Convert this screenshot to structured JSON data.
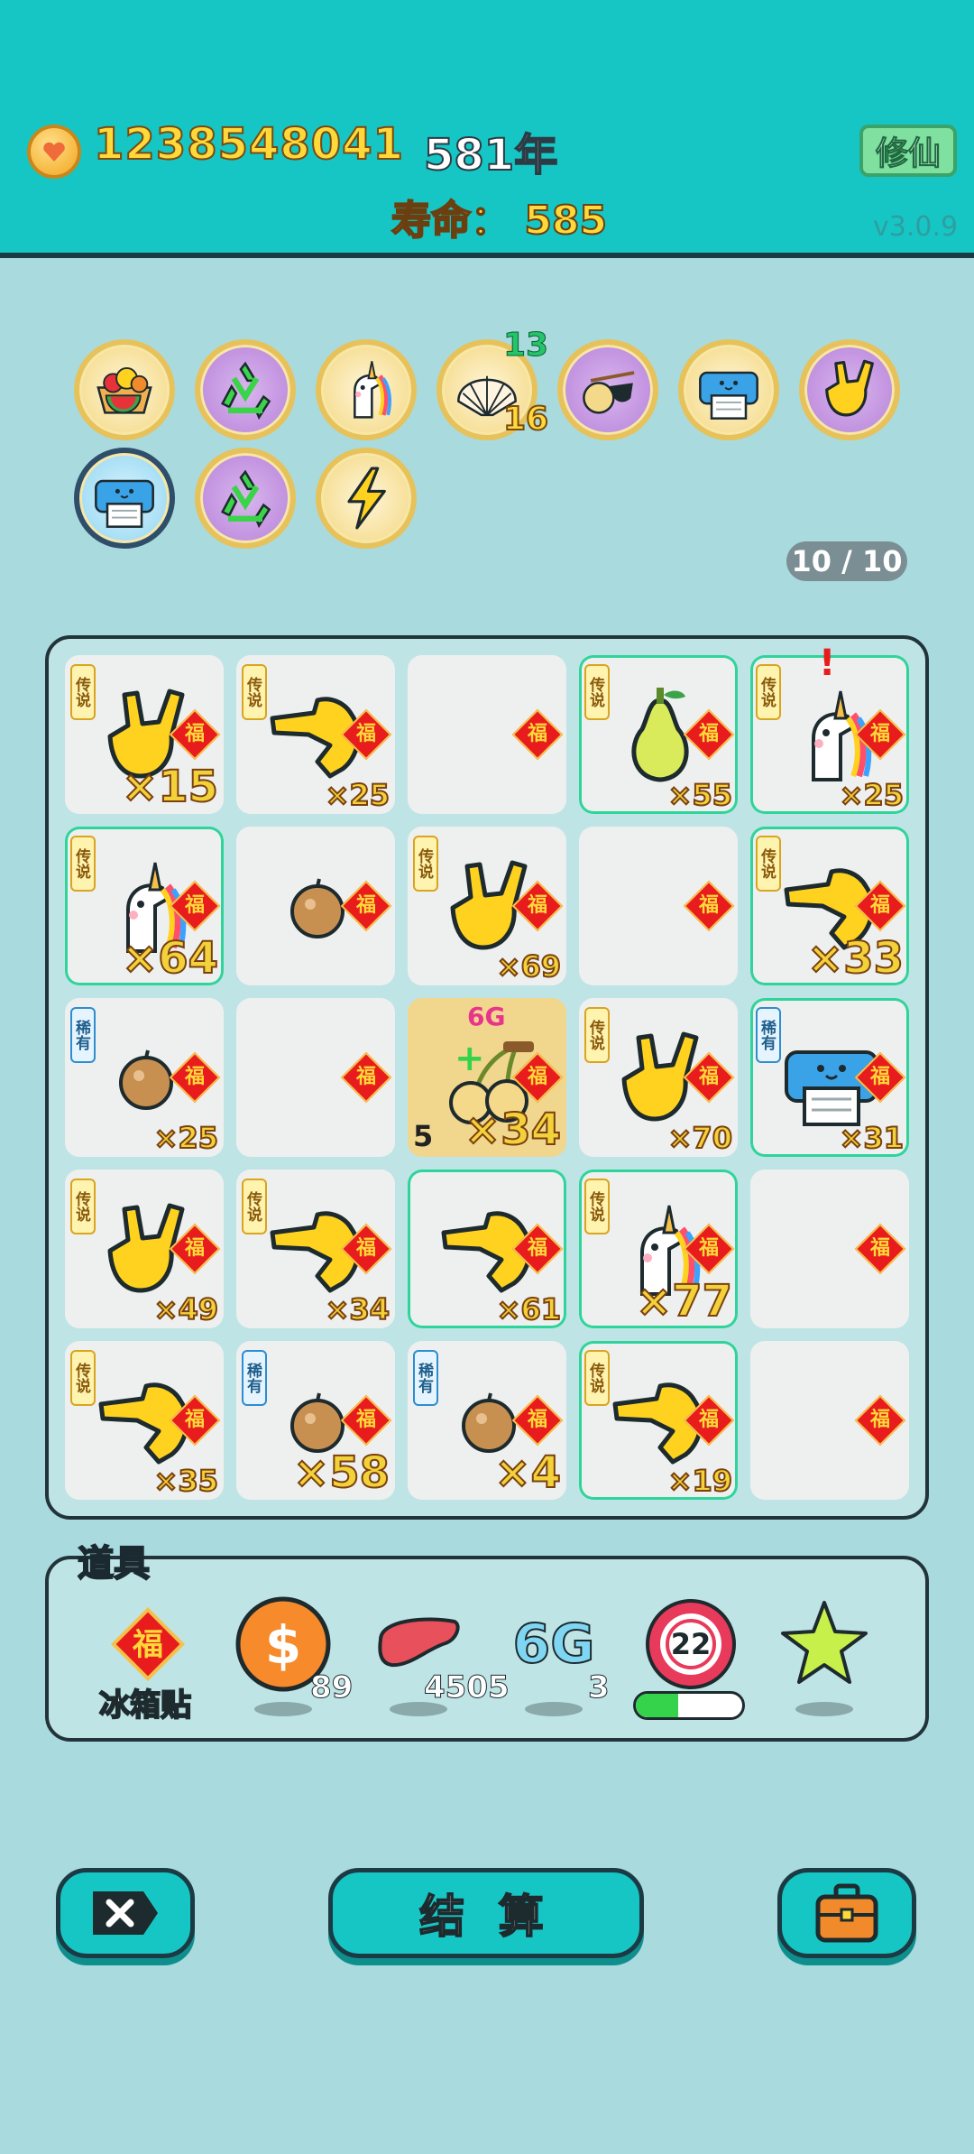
{
  "header": {
    "coins": "1238548041",
    "year": "581年",
    "lifespan": "寿命： 585",
    "xiuxian_button": "修仙",
    "version": "v3.0.9"
  },
  "buffs": [
    {
      "icon": "fruit-basket-icon",
      "style": "gold"
    },
    {
      "icon": "recycle-icon",
      "style": "purple"
    },
    {
      "icon": "unicorn-icon",
      "style": "gold"
    },
    {
      "icon": "shell-icon",
      "style": "gold",
      "top_number": "13",
      "bottom_number": "16"
    },
    {
      "icon": "sunglasses-fruit-icon",
      "style": "purple"
    },
    {
      "icon": "printer-icon",
      "style": "gold"
    },
    {
      "icon": "rock-hand-icon",
      "style": "purple"
    },
    {
      "icon": "printer-icon",
      "style": "blue"
    },
    {
      "icon": "recycle-icon",
      "style": "purple"
    },
    {
      "icon": "lightning-icon",
      "style": "gold"
    }
  ],
  "page_count": "10 / 10",
  "grid": [
    [
      {
        "tag": "传说",
        "item": "rock-hand-icon",
        "count": "×15",
        "size": "l"
      },
      {
        "tag": "传说",
        "item": "point-hand-icon",
        "count": "×25",
        "size": "s"
      },
      {
        "tag": "",
        "item": "",
        "count": "",
        "size": "s"
      },
      {
        "tag": "传说",
        "item": "pear-icon",
        "count": "×55",
        "size": "s",
        "highlight": true
      },
      {
        "tag": "传说",
        "item": "unicorn-icon",
        "count": "×25",
        "size": "s",
        "highlight": true,
        "alert": "!"
      }
    ],
    [
      {
        "tag": "传说",
        "item": "unicorn-icon",
        "count": "×64",
        "size": "l",
        "highlight": true
      },
      {
        "tag": "",
        "item": "nut-icon",
        "count": "",
        "size": "s"
      },
      {
        "tag": "传说",
        "item": "rock-hand-icon",
        "count": "×69",
        "size": "s"
      },
      {
        "tag": "",
        "item": "",
        "count": "",
        "size": "s"
      },
      {
        "tag": "传说",
        "item": "point-hand-icon",
        "count": "×33",
        "size": "l",
        "highlight": true
      }
    ],
    [
      {
        "tag": "稀有",
        "item": "nut-icon",
        "count": "×25",
        "size": "s"
      },
      {
        "tag": "",
        "item": "",
        "count": "",
        "size": "s"
      },
      {
        "tag": "",
        "item": "cherry-icon",
        "count": "×34",
        "size": "l",
        "gold": true,
        "level": "5",
        "badge": "6G"
      },
      {
        "tag": "传说",
        "item": "rock-hand-icon",
        "count": "×70",
        "size": "s"
      },
      {
        "tag": "稀有",
        "item": "printer-icon",
        "count": "×31",
        "size": "s",
        "highlight": true
      }
    ],
    [
      {
        "tag": "传说",
        "item": "rock-hand-icon",
        "count": "×49",
        "size": "s"
      },
      {
        "tag": "传说",
        "item": "point-hand-icon",
        "count": "×34",
        "size": "s"
      },
      {
        "tag": "",
        "item": "point-hand-icon",
        "count": "×61",
        "size": "s",
        "highlight": true
      },
      {
        "tag": "传说",
        "item": "unicorn-icon",
        "count": "×77",
        "size": "l",
        "highlight": true
      },
      {
        "tag": "",
        "item": "",
        "count": "",
        "size": "s"
      }
    ],
    [
      {
        "tag": "传说",
        "item": "point-hand-icon",
        "count": "×35",
        "size": "s"
      },
      {
        "tag": "稀有",
        "item": "nut-icon",
        "count": "×58",
        "size": "l"
      },
      {
        "tag": "稀有",
        "item": "nut-icon",
        "count": "×4",
        "size": "l"
      },
      {
        "tag": "传说",
        "item": "point-hand-icon",
        "count": "×19",
        "size": "s",
        "highlight": true
      },
      {
        "tag": "",
        "item": "",
        "count": "",
        "size": "s"
      }
    ]
  ],
  "fu_char": "福",
  "tools": {
    "title": "道具",
    "fridge_label": "冰箱贴",
    "dollar_count": "89",
    "liver_count": "4505",
    "g6_label": "6G",
    "g6_count": "3",
    "target_number": "22",
    "target_progress": 0.4
  },
  "buttons": {
    "settle": "结 算"
  }
}
